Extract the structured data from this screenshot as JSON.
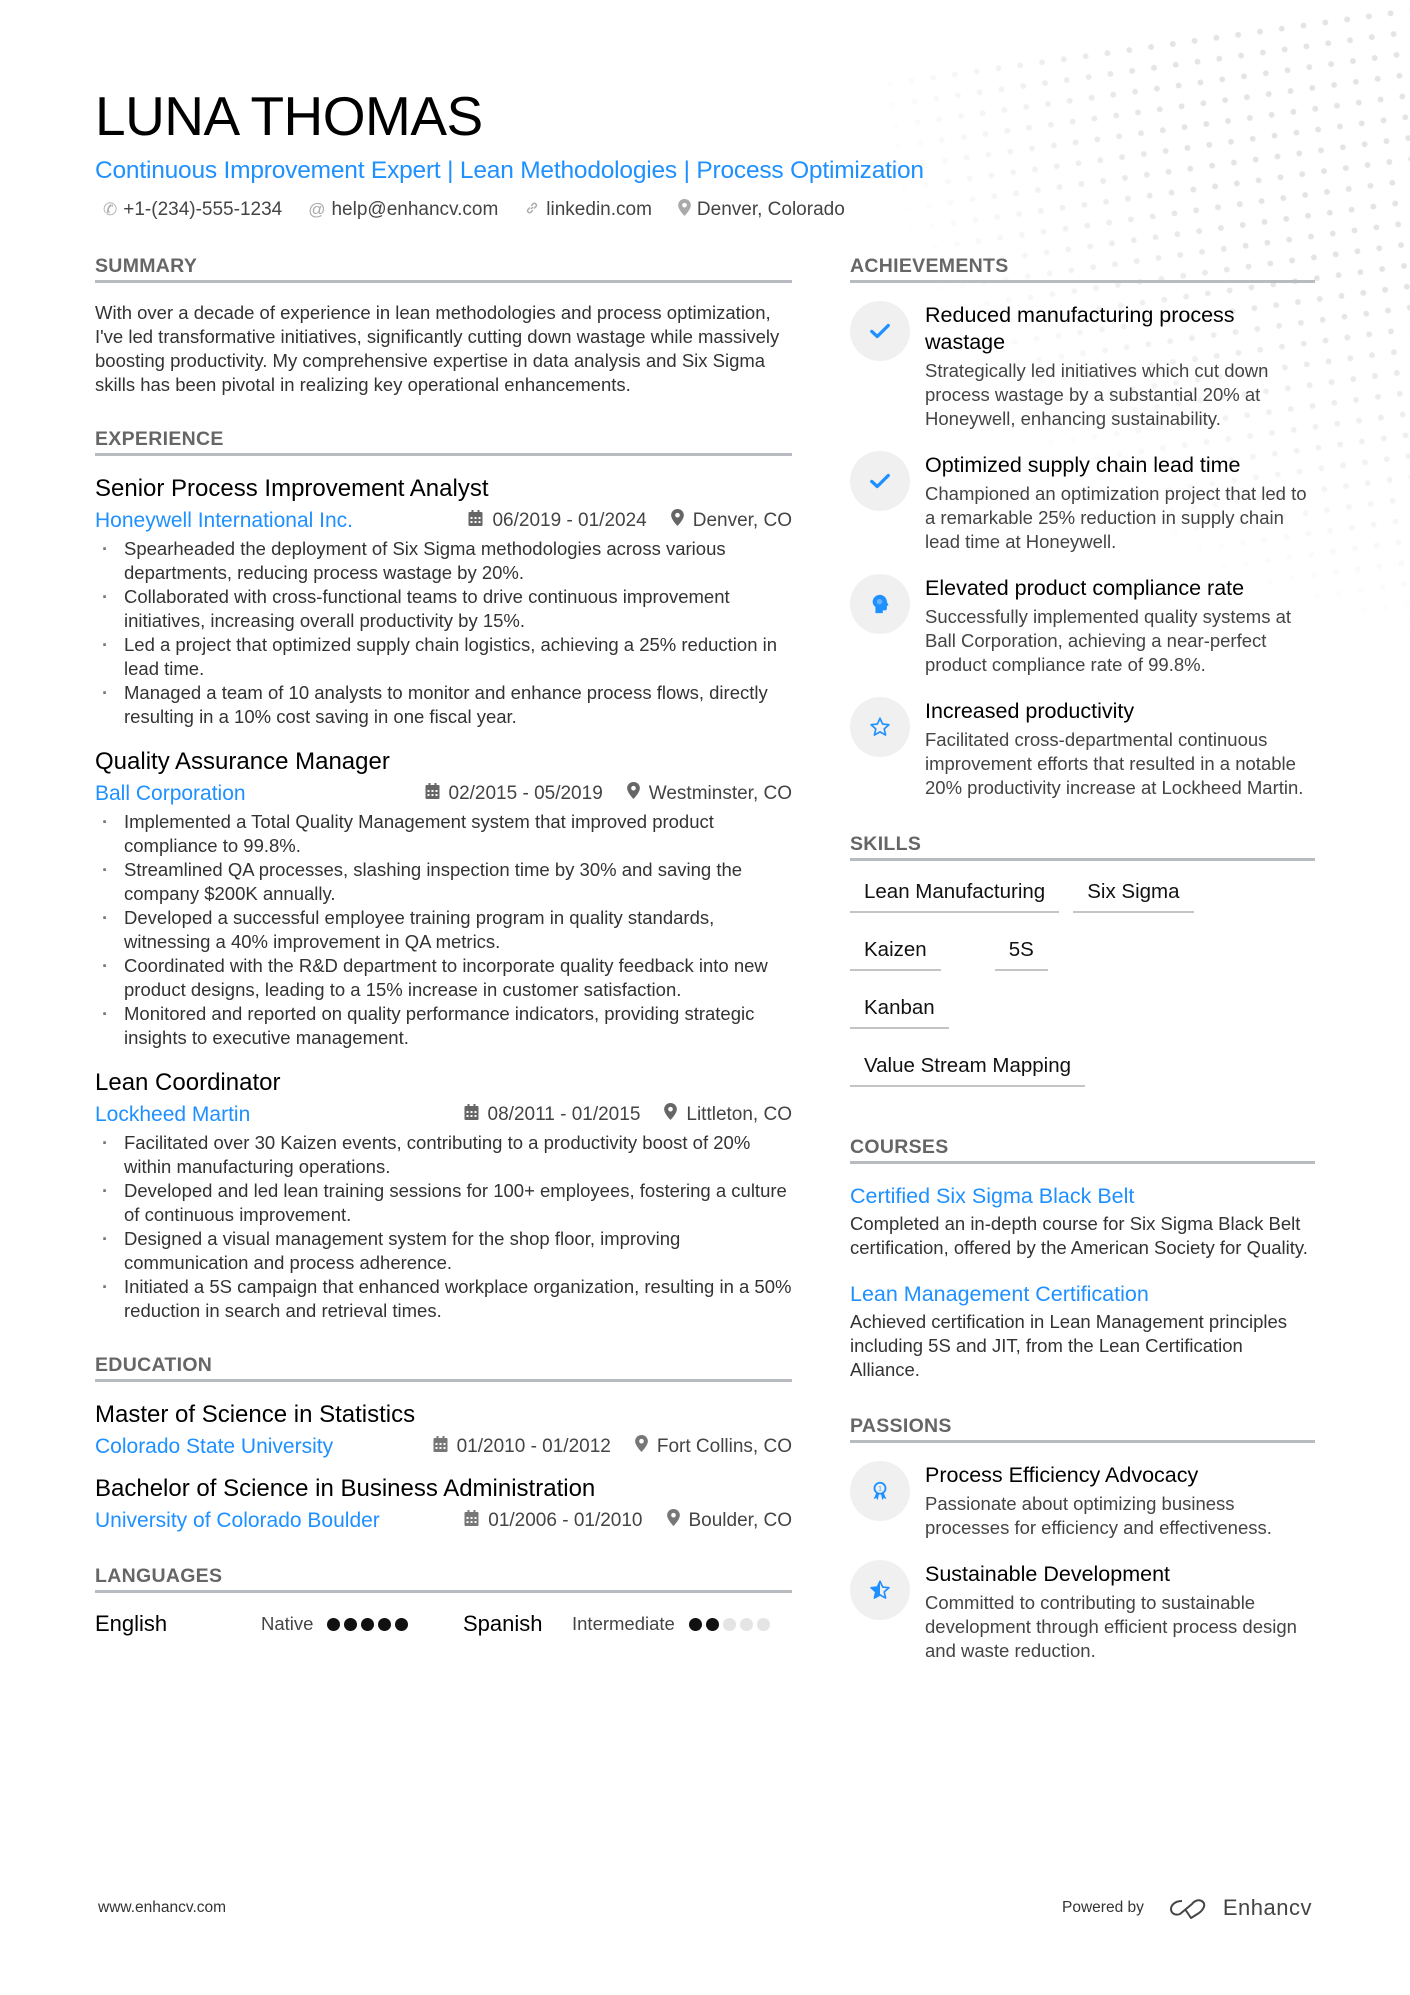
{
  "header": {
    "name": "LUNA THOMAS",
    "tagline": "Continuous Improvement Expert | Lean Methodologies | Process Optimization",
    "contacts": [
      {
        "icon": "phone-icon",
        "text": "+1-(234)-555-1234"
      },
      {
        "icon": "at-icon",
        "text": "help@enhancv.com"
      },
      {
        "icon": "link-icon",
        "text": "linkedin.com"
      },
      {
        "icon": "location-pin-icon",
        "text": "Denver, Colorado"
      }
    ]
  },
  "summary": {
    "title": "SUMMARY",
    "text": "With over a decade of experience in lean methodologies and process optimization, I've led transformative initiatives, significantly cutting down wastage while massively boosting productivity. My comprehensive expertise in data analysis and Six Sigma skills has been pivotal in realizing key operational enhancements."
  },
  "experience": {
    "title": "EXPERIENCE",
    "jobs": [
      {
        "title": "Senior Process Improvement Analyst",
        "company": "Honeywell International Inc.",
        "dates": "06/2019 - 01/2024",
        "location": "Denver, CO",
        "bullets": [
          "Spearheaded the deployment of Six Sigma methodologies across various departments, reducing process wastage by 20%.",
          "Collaborated with cross-functional teams to drive continuous improvement initiatives, increasing overall productivity by 15%.",
          "Led a project that optimized supply chain logistics, achieving a 25% reduction in lead time.",
          "Managed a team of 10 analysts to monitor and enhance process flows, directly resulting in a 10% cost saving in one fiscal year."
        ]
      },
      {
        "title": "Quality Assurance Manager",
        "company": "Ball Corporation",
        "dates": "02/2015 - 05/2019",
        "location": "Westminster, CO",
        "bullets": [
          "Implemented a Total Quality Management system that improved product compliance to 99.8%.",
          "Streamlined QA processes, slashing inspection time by 30% and saving the company $200K annually.",
          "Developed a successful employee training program in quality standards, witnessing a 40% improvement in QA metrics.",
          "Coordinated with the R&D department to incorporate quality feedback into new product designs, leading to a 15% increase in customer satisfaction.",
          "Monitored and reported on quality performance indicators, providing strategic insights to executive management."
        ]
      },
      {
        "title": "Lean Coordinator",
        "company": "Lockheed Martin",
        "dates": "08/2011 - 01/2015",
        "location": "Littleton, CO",
        "bullets": [
          "Facilitated over 30 Kaizen events, contributing to a productivity boost of 20% within manufacturing operations.",
          "Developed and led lean training sessions for 100+ employees, fostering a culture of continuous improvement.",
          "Designed a visual management system for the shop floor, improving communication and process adherence.",
          "Initiated a 5S campaign that enhanced workplace organization, resulting in a 50% reduction in search and retrieval times."
        ]
      }
    ]
  },
  "education": {
    "title": "EDUCATION",
    "items": [
      {
        "degree": "Master of Science in Statistics",
        "school": "Colorado State University",
        "dates": "01/2010 - 01/2012",
        "location": "Fort Collins, CO"
      },
      {
        "degree": "Bachelor of Science in Business Administration",
        "school": "University of Colorado Boulder",
        "dates": "01/2006 - 01/2010",
        "location": "Boulder, CO"
      }
    ]
  },
  "languages": {
    "title": "LANGUAGES",
    "items": [
      {
        "name": "English",
        "level": "Native",
        "rating": 5,
        "max": 5
      },
      {
        "name": "Spanish",
        "level": "Intermediate",
        "rating": 2,
        "max": 5
      }
    ]
  },
  "achievements": {
    "title": "ACHIEVEMENTS",
    "items": [
      {
        "icon": "checkmark-icon",
        "title": "Reduced manufacturing process wastage",
        "desc": "Strategically led initiatives which cut down process wastage by a substantial 20% at Honeywell, enhancing sustainability."
      },
      {
        "icon": "checkmark-icon",
        "title": "Optimized supply chain lead time",
        "desc": "Championed an optimization project that led to a remarkable 25% reduction in supply chain lead time at Honeywell."
      },
      {
        "icon": "head-brain-icon",
        "title": "Elevated product compliance rate",
        "desc": "Successfully implemented quality systems at Ball Corporation, achieving a near-perfect product compliance rate of 99.8%."
      },
      {
        "icon": "star-outline-icon",
        "title": "Increased productivity",
        "desc": "Facilitated cross-departmental continuous improvement efforts that resulted in a notable 20% productivity increase at Lockheed Martin."
      }
    ]
  },
  "skills": {
    "title": "SKILLS",
    "items": [
      "Lean Manufacturing",
      "Six Sigma",
      "Kaizen",
      "5S",
      "Kanban",
      "Value Stream Mapping"
    ]
  },
  "courses": {
    "title": "COURSES",
    "items": [
      {
        "title": "Certified Six Sigma Black Belt",
        "desc": "Completed an in-depth course for Six Sigma Black Belt certification, offered by the American Society for Quality."
      },
      {
        "title": "Lean Management Certification",
        "desc": "Achieved certification in Lean Management principles including 5S and JIT, from the Lean Certification Alliance."
      }
    ]
  },
  "passions": {
    "title": "PASSIONS",
    "items": [
      {
        "icon": "award-ribbon-icon",
        "title": "Process Efficiency Advocacy",
        "desc": "Passionate about optimizing business processes for efficiency and effectiveness."
      },
      {
        "icon": "half-star-icon",
        "title": "Sustainable Development",
        "desc": "Committed to contributing to sustainable development through efficient process design and waste reduction."
      }
    ]
  },
  "footer": {
    "website": "www.enhancv.com",
    "powered_by": "Powered by",
    "brand": "Enhancv"
  },
  "colors": {
    "accent": "#1e90ff",
    "text": "#2b2b2b",
    "rule": "#b8bcc0",
    "icon_bg": "#f0f0f1"
  }
}
